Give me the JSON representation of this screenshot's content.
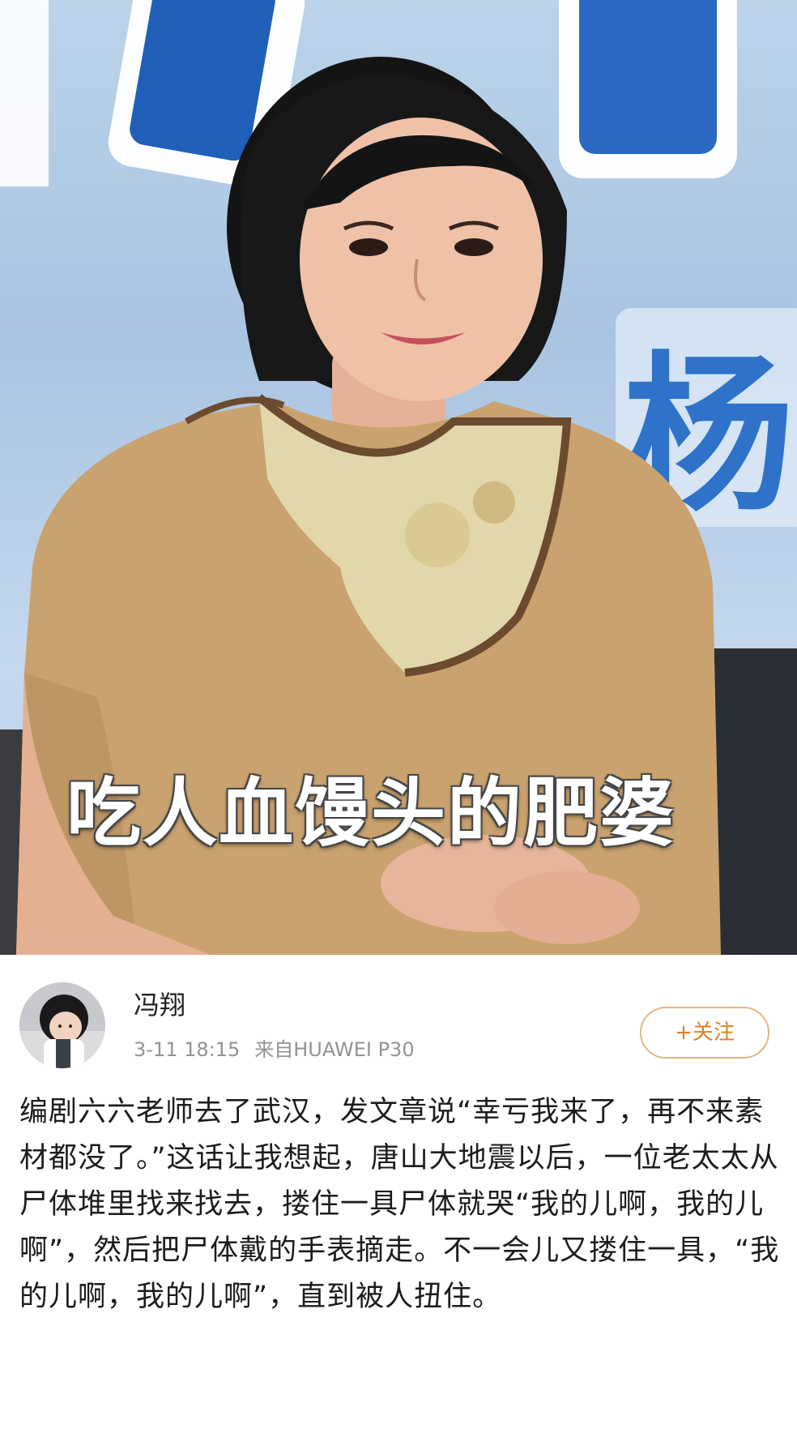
{
  "photo": {
    "caption": "吃人血馒头的肥婆",
    "background_sign_char": "杨"
  },
  "post": {
    "author": {
      "name": "冯翔",
      "avatar": "avatar-image"
    },
    "meta": {
      "time": "3-11 18:15",
      "source": "来自HUAWEI P30"
    },
    "follow_button": {
      "label": "+关注",
      "color": "#e07f21"
    },
    "text": "编剧六六老师去了武汉，发文章说“幸亏我来了，再不来素材都没了。”这话让我想起，唐山大地震以后，一位老太太从尸体堆里找来找去，搂住一具尸体就哭“我的儿啊，我的儿啊”，然后把尸体戴的手表摘走。不一会儿又搂住一具，“我的儿啊，我的儿啊”，直到被人扭住。"
  }
}
